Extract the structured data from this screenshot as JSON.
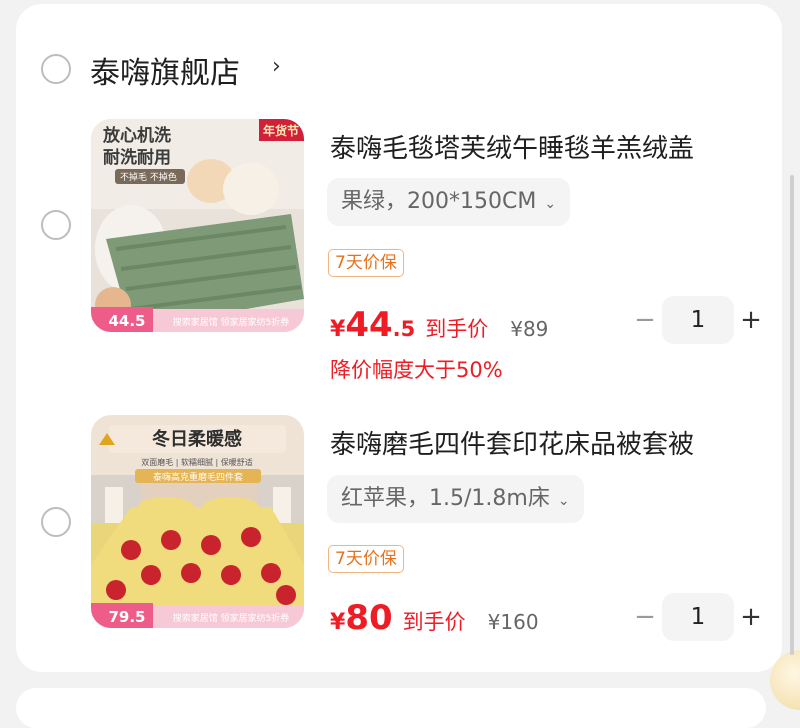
{
  "store": {
    "name": "泰嗨旗舰店",
    "chevron": "›"
  },
  "items": [
    {
      "title": "泰嗨毛毯塔芙绒午睡毯羊羔绒盖",
      "sku": "果绿，200*150CM",
      "tag": "7天价保",
      "price_yen": "¥",
      "price_int": "44",
      "price_dec": ".5",
      "price_label": "到手价",
      "orig_price": "¥89",
      "discount": "降价幅度大于50%",
      "quantity": "1",
      "image": {
        "headline1": "放心机洗",
        "headline2": "耐洗耐用",
        "sub": "不掉毛 不掉色",
        "badge": "年货节",
        "price": "44.5",
        "bottom": "搜索家居馆 领家居家纺5折券"
      }
    },
    {
      "title": "泰嗨磨毛四件套印花床品被套被",
      "sku": "红苹果，1.5/1.8m床",
      "tag": "7天价保",
      "price_yen": "¥",
      "price_int": "80",
      "price_dec": "",
      "price_label": "到手价",
      "orig_price": "¥160",
      "discount": "",
      "quantity": "1",
      "image": {
        "headline": "冬日柔暖感",
        "features": "双面磨毛 | 软糯细腻 | 保暖舒适",
        "sub": "泰嗨高克重磨毛四件套",
        "price": "79.5",
        "bottom": "搜索家居馆 领家居家纺5折券"
      }
    }
  ],
  "stepper": {
    "minus": "−",
    "plus": "+"
  },
  "colors": {
    "price_red": "#ee1c25",
    "tag_orange": "#e8721c",
    "background": "#f2f2f2"
  }
}
